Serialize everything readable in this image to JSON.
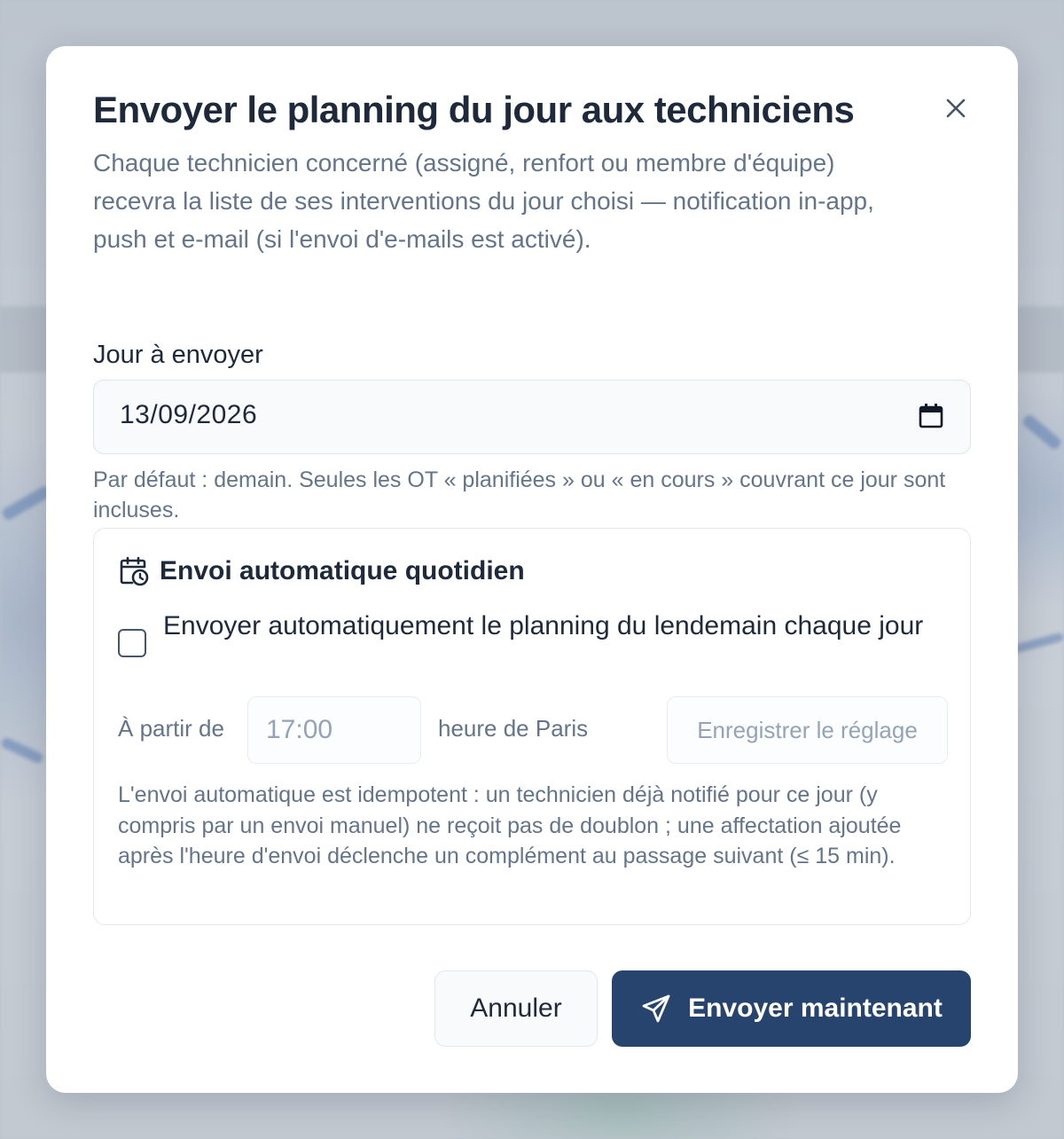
{
  "dialog": {
    "title": "Envoyer le planning du jour aux techniciens",
    "description": "Chaque technicien concerné (assigné, renfort ou membre d'équipe) recevra la liste de ses interventions du jour choisi — notification in-app, push et e-mail (si l'envoi d'e-mails est activé).",
    "close_icon": "close-icon"
  },
  "day_field": {
    "label": "Jour à envoyer",
    "value": "13/09/2026",
    "icon": "calendar-icon",
    "hint": "Par défaut : demain. Seules les OT « planifiées » ou « en cours » couvrant ce jour sont incluses."
  },
  "auto_send": {
    "icon": "calendar-clock-icon",
    "title": "Envoi automatique quotidien",
    "checkbox_label": "Envoyer automatiquement le planning du lendemain chaque jour",
    "checked": false,
    "from_label": "À partir de",
    "time_value": "17:00",
    "timezone_label": "heure de Paris",
    "save_label": "Enregistrer le réglage",
    "note": "L'envoi automatique est idempotent : un technicien déjà notifié pour ce jour (y compris par un envoi manuel) ne reçoit pas de doublon ; une affectation ajoutée après l'heure d'envoi déclenche un complément au passage suivant (≤ 15 min)."
  },
  "actions": {
    "cancel_label": "Annuler",
    "send_label": "Envoyer maintenant",
    "send_icon": "send-icon"
  },
  "colors": {
    "primary": "#27446e",
    "text": "#1e293b",
    "muted": "#64748b"
  }
}
